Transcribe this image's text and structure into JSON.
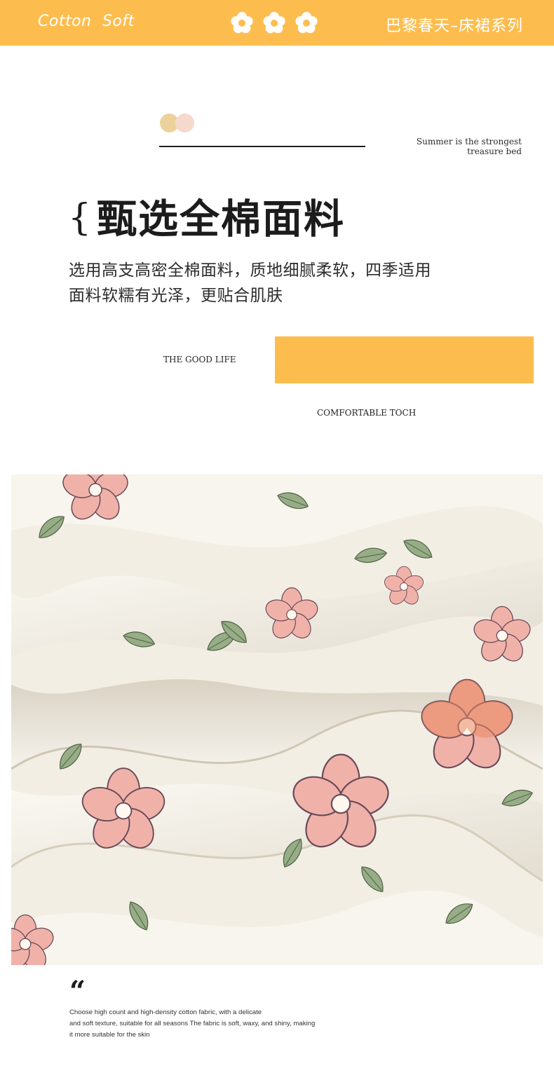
{
  "header": {
    "brand": "Cotton  Soft",
    "series": "巴黎春天–床裙系列",
    "flower_icons": [
      "flower-icon",
      "flower-icon",
      "flower-icon"
    ]
  },
  "tagline": {
    "line1": "Summer is the strongest",
    "line2": "treasure bed"
  },
  "section": {
    "brace": "{",
    "title": "甄选全棉面料",
    "desc_line1": "选用高支高密全棉面料，质地细腻柔软，四季适用",
    "desc_line2": "面料软糯有光泽，更贴合肌肤"
  },
  "labels": {
    "good_life": "THE GOOD LIFE",
    "comfortable": "COMFORTABLE TOCH"
  },
  "quote": {
    "mark": "“",
    "line1": "Choose high count and high-density cotton fabric, with a delicate",
    "line2": "and soft texture, suitable for all seasons The fabric is soft, waxy, and shiny, making",
    "line3": "it more suitable for the skin"
  },
  "colors": {
    "accent": "#fdbd4e",
    "dot_left": "#ecd29a",
    "dot_right": "#f4d9cc",
    "text": "#1c1c1c"
  }
}
